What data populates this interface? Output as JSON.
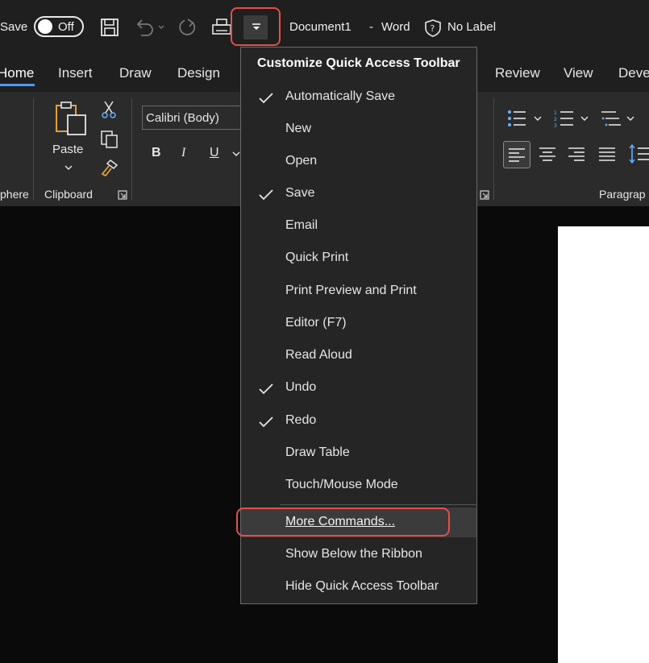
{
  "quick_access": {
    "autosave_label": "Save",
    "autosave_state": "Off",
    "document_title": "Document1",
    "title_separator": "-",
    "app_name": "Word",
    "sensitivity_label": "No Label"
  },
  "ribbon_tabs": [
    "Home",
    "Insert",
    "Draw",
    "Design",
    "Review",
    "View",
    "Deve"
  ],
  "ribbon": {
    "paste_label": "Paste",
    "font_name": "Calibri (Body)",
    "bold": "B",
    "italic": "I",
    "underline": "U",
    "groups": {
      "ambient_partial": "phere",
      "clipboard": "Clipboard",
      "paragraph_partial": "Paragrap"
    }
  },
  "menu": {
    "title": "Customize Quick Access Toolbar",
    "items": [
      {
        "label": "Automatically Save",
        "checked": true
      },
      {
        "label": "New",
        "checked": false
      },
      {
        "label": "Open",
        "checked": false
      },
      {
        "label": "Save",
        "checked": true
      },
      {
        "label": "Email",
        "checked": false
      },
      {
        "label": "Quick Print",
        "checked": false
      },
      {
        "label": "Print Preview and Print",
        "checked": false
      },
      {
        "label": "Editor (F7)",
        "checked": false
      },
      {
        "label": "Read Aloud",
        "checked": false
      },
      {
        "label": "Undo",
        "checked": true
      },
      {
        "label": "Redo",
        "checked": true
      },
      {
        "label": "Draw Table",
        "checked": false
      },
      {
        "label": "Touch/Mouse Mode",
        "checked": false
      }
    ],
    "more_commands_label": "More Commands...",
    "show_below_label": "Show Below the Ribbon",
    "hide_label": "Hide Quick Access Toolbar"
  },
  "colors": {
    "highlight_outline": "#e0514c",
    "accent": "#4b9bff",
    "menu_bg": "#252525",
    "ribbon_bg": "#2b2b2b",
    "titlebar_bg": "#1f1f1f"
  },
  "icons": [
    "save-icon",
    "undo-icon",
    "redo-icon",
    "print-icon",
    "customize-qat-icon",
    "sensitivity-shield-icon",
    "paste-icon",
    "cut-icon",
    "copy-icon",
    "format-painter-icon",
    "bullets-icon",
    "numbering-icon",
    "multilevel-list-icon",
    "align-left-icon",
    "align-center-icon",
    "align-right-icon",
    "justify-icon",
    "line-spacing-icon",
    "checkmark-icon"
  ]
}
